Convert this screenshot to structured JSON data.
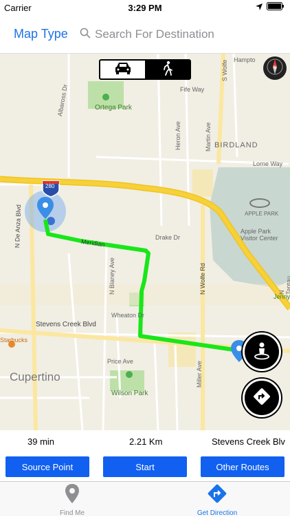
{
  "status_bar": {
    "carrier": "Carrier",
    "time": "3:29 PM"
  },
  "nav_bar": {
    "map_type_label": "Map Type",
    "search_placeholder": "Search For Destination"
  },
  "map": {
    "labels": {
      "ortega_park": "Ortega Park",
      "birdland": "BIRDLAND",
      "apple_park": "APPLE PARK",
      "apple_park_visitor": "Apple Park Visitor Center",
      "cupertino": "Cupertino",
      "wilson_park": "Wilson Park",
      "starbucks": "Starbucks",
      "stevens_creek": "Stevens Creek Blvd",
      "shield_280": "280",
      "n_de_anza": "N De Anza Blvd",
      "n_wolfe": "N Wolfe Rd",
      "miller_ave": "Miller Ave",
      "n_blaney": "N Blaney Ave",
      "n_tantau": "N Tantau Ave",
      "meridian": "Meridian",
      "lorne_way": "Lorne Way",
      "fife_way": "Fife Way",
      "drake_dr": "Drake Dr",
      "wheaton_dr": "Wheaton Dr",
      "price_ave": "Price Ave",
      "jenny": "Jenny",
      "albaross_dr": "Albaross Dr",
      "heron_ave": "Heron Ave",
      "martin_ave": "Martin Ave",
      "hampton": "Hampto",
      "s_wolfe": "S Wolfe"
    }
  },
  "mode_toggle": {
    "options": [
      "car",
      "walk"
    ],
    "selected": "walk"
  },
  "stats": {
    "duration": "39 min",
    "distance": "2.21 Km",
    "destination": "Stevens Creek Blv"
  },
  "buttons": {
    "source_point": "Source Point",
    "start": "Start",
    "other_routes": "Other Routes"
  },
  "tab_bar": {
    "find_me": "Find Me",
    "get_direction": "Get Direction"
  },
  "colors": {
    "accent": "#1a73e8",
    "button_blue": "#1160f0",
    "route_green": "#19e619",
    "freeway_yellow": "#f7d13c",
    "park_green": "#bde0a8"
  }
}
